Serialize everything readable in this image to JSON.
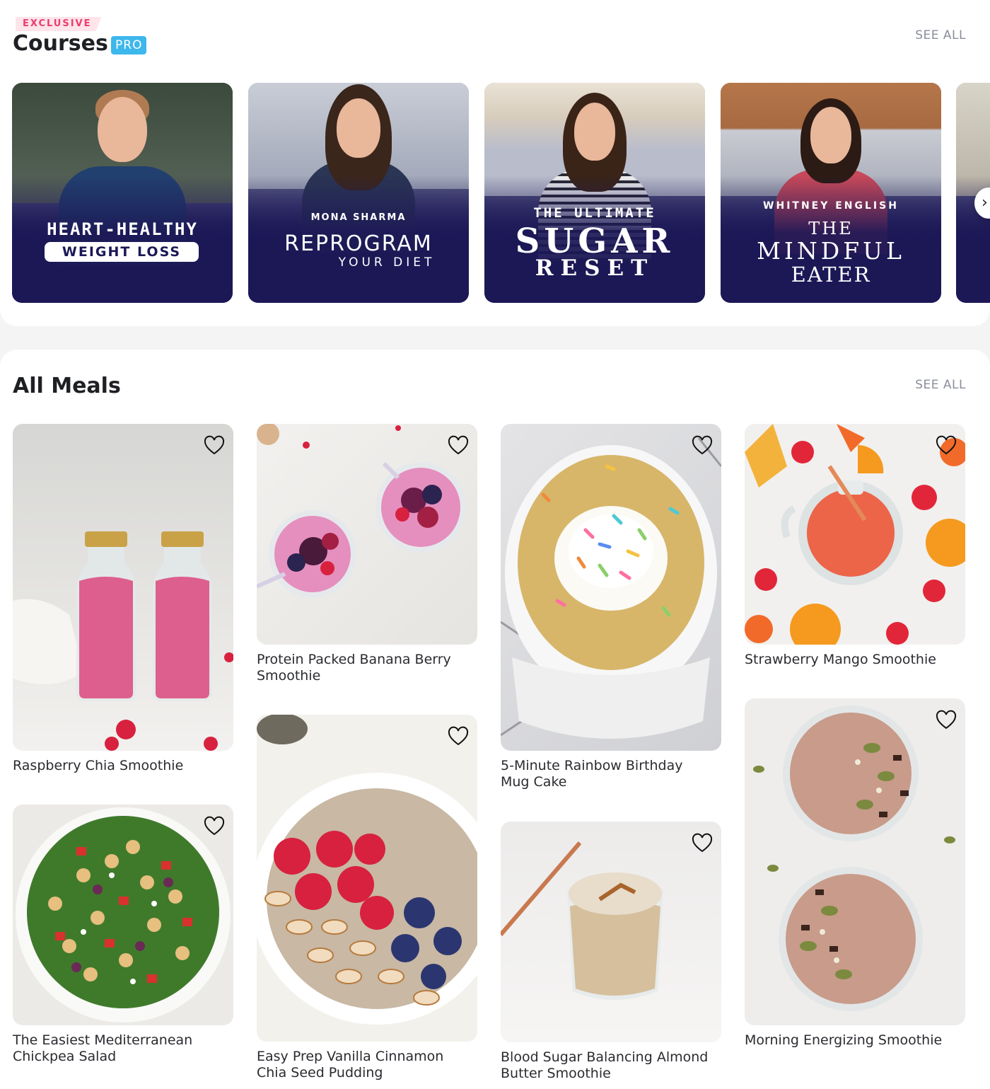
{
  "courses": {
    "badge": "EXCLUSIVE",
    "title": "Courses",
    "pro": "PRO",
    "see_all": "SEE ALL",
    "items": [
      {
        "line1": "HEART-HEALTHY",
        "line2": "WEIGHT LOSS"
      },
      {
        "author": "MONA SHARMA",
        "line1": "REPROGRAM",
        "line2": "YOUR DIET"
      },
      {
        "line0": "THE ULTIMATE",
        "line1": "SUGAR",
        "line2": "RESET"
      },
      {
        "author": "WHITNEY ENGLISH",
        "line0": "THE",
        "line1": "MINDFUL",
        "line2": "EATER"
      }
    ],
    "next_icon": "›"
  },
  "meals": {
    "title": "All Meals",
    "see_all": "SEE ALL",
    "items": [
      {
        "name": "Raspberry Chia Smoothie"
      },
      {
        "name": "Protein Packed Banana Berry Smoothie"
      },
      {
        "name": "5-Minute Rainbow Birthday Mug Cake"
      },
      {
        "name": "Strawberry Mango Smoothie"
      },
      {
        "name": "The Easiest Mediterranean Chickpea Salad"
      },
      {
        "name": "Easy Prep Vanilla Cinnamon Chia Seed Pudding"
      },
      {
        "name": "Blood Sugar Balancing Almond Butter Smoothie"
      },
      {
        "name": "Morning Energizing Smoothie"
      }
    ]
  },
  "icons": {
    "favorite": "heart-outline-icon",
    "next": "chevron-right-icon"
  },
  "colors": {
    "accent_pink": "#ea3d6d",
    "pro_blue": "#3db7ec",
    "course_navy": "#1c1856",
    "muted_text": "#8a8d9a"
  }
}
